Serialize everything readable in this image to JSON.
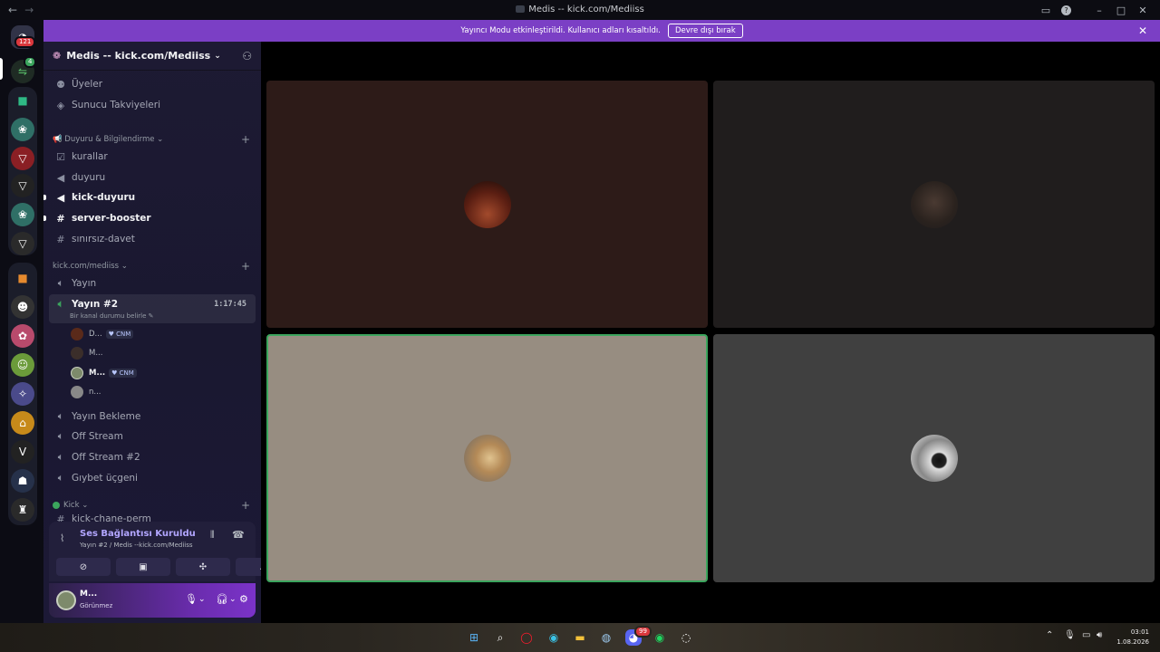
{
  "window": {
    "title": "Medis -- kick.com/Mediiss"
  },
  "banner": {
    "text": "Yayıncı Modu etkinleştirildi. Kullanıcı adları kısaltıldı.",
    "button": "Devre dışı bırak"
  },
  "rail": {
    "dm_badge": "121",
    "notify_badge": "4"
  },
  "server": {
    "name": "Medis -- kick.com/Mediiss"
  },
  "top_items": [
    {
      "label": "Üyeler",
      "icon": "members-icon"
    },
    {
      "label": "Sunucu Takviyeleri",
      "icon": "boost-icon"
    }
  ],
  "categories": {
    "announce": "📢 Duyuru & Bilgilendirme",
    "kick": "kick.com/mediiss",
    "kick2": "Kick"
  },
  "channels_announce": [
    {
      "label": "kurallar",
      "icon": "rules-icon"
    },
    {
      "label": "duyuru",
      "icon": "megaphone-icon"
    },
    {
      "label": "kick-duyuru",
      "icon": "megaphone-icon"
    },
    {
      "label": "server-booster",
      "icon": "hash-icon"
    },
    {
      "label": "sınırsız-davet",
      "icon": "hash-icon"
    }
  ],
  "channels_kick": [
    {
      "label": "Yayın"
    },
    {
      "label": "Yayın #2",
      "timer": "1:17:45",
      "status": "Bir kanal durumu belirle"
    },
    {
      "label": "Yayın Bekleme"
    },
    {
      "label": "Off Stream"
    },
    {
      "label": "Off Stream #2"
    },
    {
      "label": "Gıybet üçgeni"
    }
  ],
  "voice_users": [
    {
      "name": "D...",
      "tag": "CNM"
    },
    {
      "name": "M...",
      "tag": ""
    },
    {
      "name": "M...",
      "tag": "CNM"
    },
    {
      "name": "n...",
      "tag": ""
    }
  ],
  "partial_channel": "kick-chane-perm",
  "voice_panel": {
    "status": "Ses Bağlantısı Kuruldu",
    "channel": "Yayın #2 / Medis --kick.com/Mediiss"
  },
  "user": {
    "name": "M...",
    "status": "Görünmez"
  },
  "taskbar": {
    "time": "03:01",
    "date": "1.08.2026",
    "discord_badge": "99"
  },
  "colors": {
    "accent": "#7b3fc5",
    "sidebar": "#1d1a33",
    "speaking_border": "#3ba55d"
  }
}
